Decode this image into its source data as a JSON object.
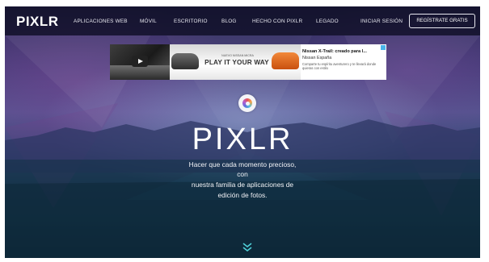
{
  "nav": {
    "logo": "PIXLR",
    "items": [
      "APLICACIONES WEB",
      "MÓVIL",
      "ESCRITORIO",
      "BLOG",
      "HECHO CON PIXLR",
      "LEGADO"
    ],
    "login": "INICIAR SESIÓN",
    "signup": "REGÍSTRATE GRATIS"
  },
  "ad": {
    "banner_small": "NUEVO NISSAN MICRA",
    "banner_big": "PLAY IT YOUR WAY",
    "title": "Nissan X-Trail: creado para l...",
    "brand": "Nissan España",
    "description": "Comparte tu espíritu aventurero y te llevará donde quieras con estilo"
  },
  "hero": {
    "title": "PIXLR",
    "tagline": [
      "Hacer que cada momento precioso,",
      "con",
      "nuestra familia de aplicaciones de",
      "edición de fotos."
    ]
  },
  "icons": {
    "logo_emblem": "pixlr-logo-icon",
    "scroll": "double-chevron-down-icon",
    "play": "play-icon"
  },
  "colors": {
    "nav_bg": "#0e0e24",
    "text": "#ffffff",
    "scroll_arrow": "#4fd0d8"
  }
}
